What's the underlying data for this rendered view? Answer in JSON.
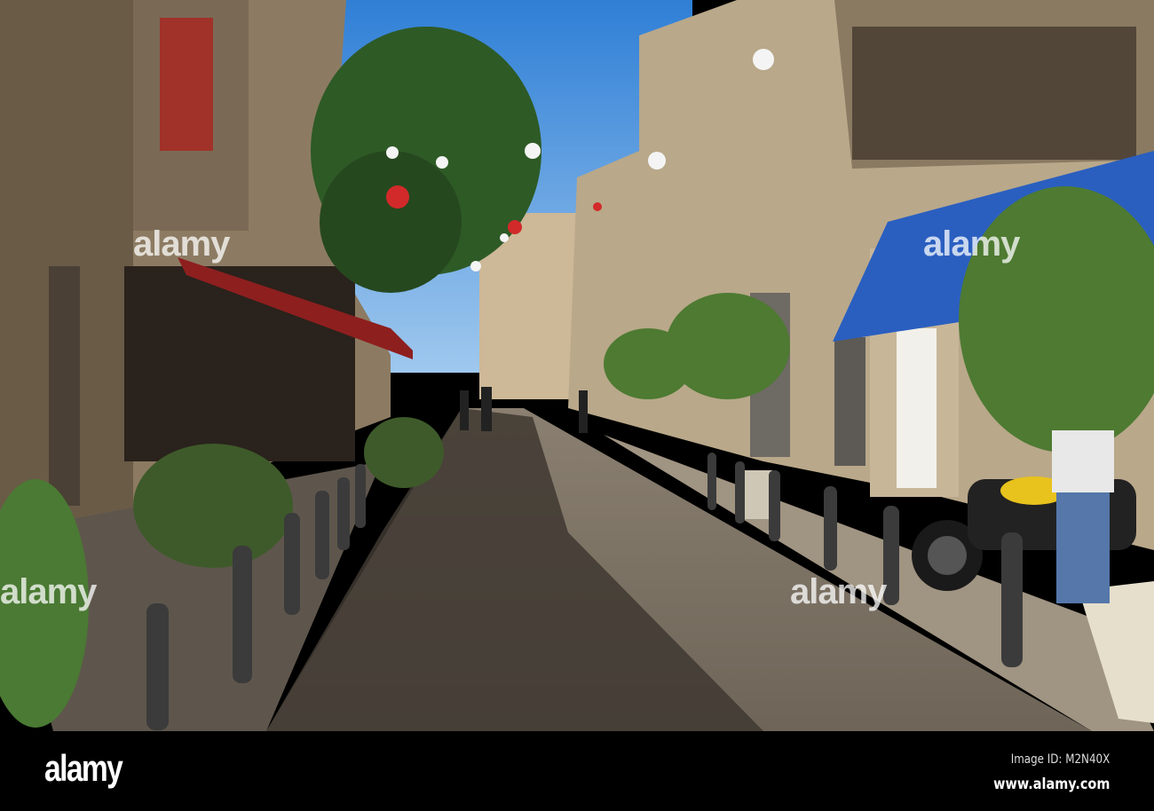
{
  "photo": {
    "subject": "cobblestone street",
    "colors": {
      "sky": "#3f8fd8",
      "awning": "#2a5fc0",
      "stone": "#6b6257",
      "shadow": "#3a342e"
    }
  },
  "watermark": {
    "text": "alamy"
  },
  "footer": {
    "logo": "alamy",
    "image_id": "Image ID: M2N40X",
    "url": "www.alamy.com"
  }
}
